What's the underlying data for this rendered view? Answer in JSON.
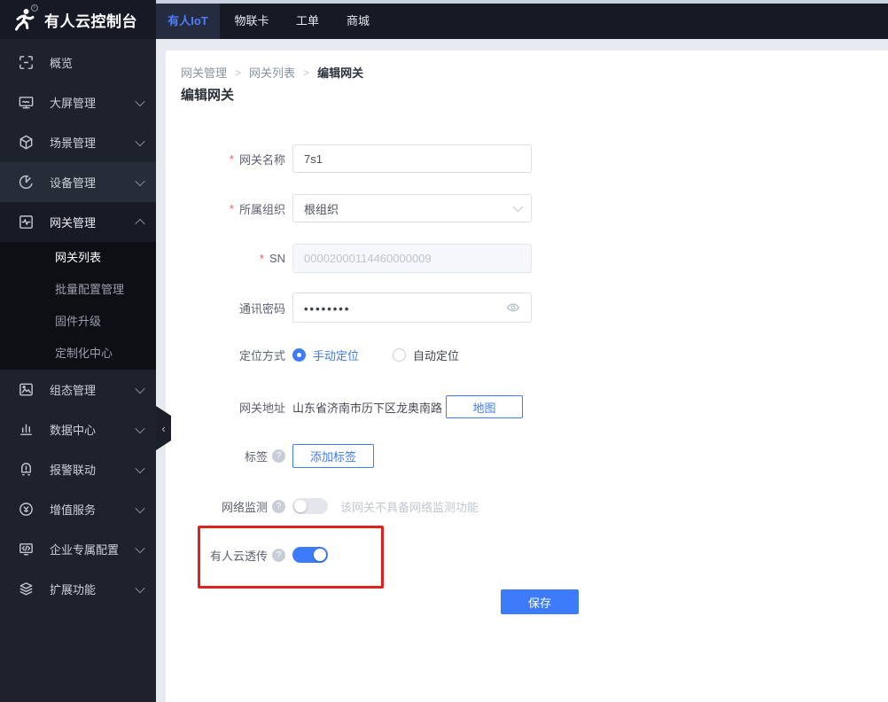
{
  "colors": {
    "accent": "#3e7bfa",
    "accent_light": "#4c7eff",
    "annotation_red": "#e01f1f",
    "nav_bg": "#161a25",
    "tab_active_bg": "#262c3f",
    "sidebar_bg": "#1e222d",
    "sidebar_hover_bg": "#272c39",
    "sidebar_expanded_bg": "#181b25",
    "submenu_bg": "#0d0f15",
    "page_bg": "#e7eaf1",
    "top_strip": "#c9d2e2"
  },
  "logo": {
    "title": "有人云控制台",
    "registered_mark": "®",
    "icon": "runner-icon"
  },
  "topnav": {
    "tabs": [
      {
        "label": "有人IoT",
        "active": true
      },
      {
        "label": "物联卡",
        "active": false
      },
      {
        "label": "工单",
        "active": false
      },
      {
        "label": "商城",
        "active": false
      }
    ]
  },
  "sidebar": {
    "items": [
      {
        "label": "概览",
        "icon": "overview-icon",
        "expandable": false
      },
      {
        "label": "大屏管理",
        "icon": "screen-icon",
        "expandable": true
      },
      {
        "label": "场景管理",
        "icon": "scene-cube-icon",
        "expandable": true
      },
      {
        "label": "设备管理",
        "icon": "device-pie-icon",
        "expandable": true,
        "hover": true
      },
      {
        "label": "网关管理",
        "icon": "gateway-icon",
        "expandable": true,
        "expanded": true
      },
      {
        "label": "组态管理",
        "icon": "scada-picture-icon",
        "expandable": true
      },
      {
        "label": "数据中心",
        "icon": "data-bars-icon",
        "expandable": true
      },
      {
        "label": "报警联动",
        "icon": "alarm-bell-icon",
        "expandable": true
      },
      {
        "label": "增值服务",
        "icon": "value-service-icon",
        "expandable": true
      },
      {
        "label": "企业专属配置",
        "icon": "enterprise-monitor-icon",
        "expandable": true
      },
      {
        "label": "扩展功能",
        "icon": "extension-layers-icon",
        "expandable": true
      }
    ],
    "submenu": {
      "parent": "网关管理",
      "items": [
        {
          "label": "网关列表",
          "active": true
        },
        {
          "label": "批量配置管理",
          "active": false
        },
        {
          "label": "固件升级",
          "active": false
        },
        {
          "label": "定制化中心",
          "active": false
        }
      ]
    },
    "collapse_hint": "‹"
  },
  "breadcrumb": {
    "separator": ">",
    "items": [
      "网关管理",
      "网关列表",
      "编辑网关"
    ]
  },
  "page": {
    "title": "编辑网关"
  },
  "form": {
    "required_mark": "*",
    "fields": {
      "gateway_name": {
        "label": "网关名称",
        "required": true,
        "value": "7s1"
      },
      "organization": {
        "label": "所属组织",
        "required": true,
        "value": "根组织"
      },
      "sn": {
        "label": "SN",
        "required": true,
        "value": "00002000114460000009",
        "disabled": true
      },
      "comm_password": {
        "label": "通讯密码",
        "value": "••••••••",
        "masked": true
      },
      "positioning": {
        "label": "定位方式",
        "options": [
          {
            "label": "手动定位",
            "selected": true
          },
          {
            "label": "自动定位",
            "selected": false
          }
        ]
      },
      "address": {
        "label": "网关地址",
        "value": "山东省济南市历下区龙奥南路",
        "map_button_label": "地图"
      },
      "tags": {
        "label": "标签",
        "help_icon": "?",
        "add_button_label": "添加标签"
      },
      "network_monitor": {
        "label": "网络监测",
        "help_icon": "?",
        "enabled": false,
        "disabled_hint": "该网关不具备网络监测功能"
      },
      "cloud_passthrough": {
        "label": "有人云透传",
        "help_icon": "?",
        "enabled": true
      }
    },
    "save_button_label": "保存"
  },
  "annotation": {
    "shape": "red-rectangle",
    "highlights": "有人云透传 toggle row"
  }
}
